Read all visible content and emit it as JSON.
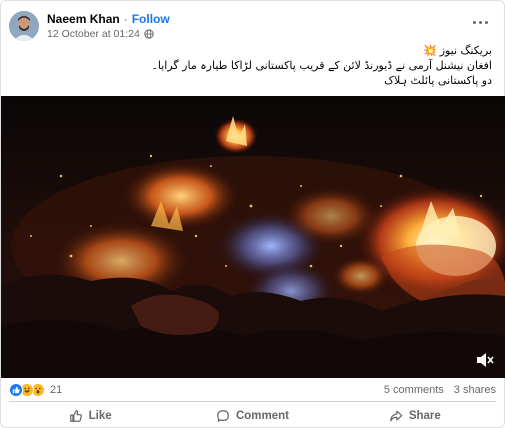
{
  "author": {
    "name": "Naeem Khan",
    "follow_label": "Follow",
    "timestamp": "12 October at 01:24",
    "separator": "·"
  },
  "post": {
    "lines": [
      "بریکنگ نیوز",
      "افغان نیشنل آرمی نے ڈیورنڈ لائن کے قریب پاکستانی لڑاکا طیارہ مار گرایا۔",
      "دو پاکستانی پائلٹ ہلاک"
    ],
    "spark_icon": "💥"
  },
  "video": {
    "mute_icon": "speaker-muted-icon"
  },
  "stats": {
    "reaction_count": "21",
    "comments": "5 comments",
    "shares": "3 shares",
    "reactions": [
      "like",
      "haha",
      "wow"
    ]
  },
  "actions": {
    "like": "Like",
    "comment": "Comment",
    "share": "Share"
  },
  "colors": {
    "accent": "#1877f2",
    "secondary_text": "#65676b",
    "divider": "#ced0d4"
  }
}
